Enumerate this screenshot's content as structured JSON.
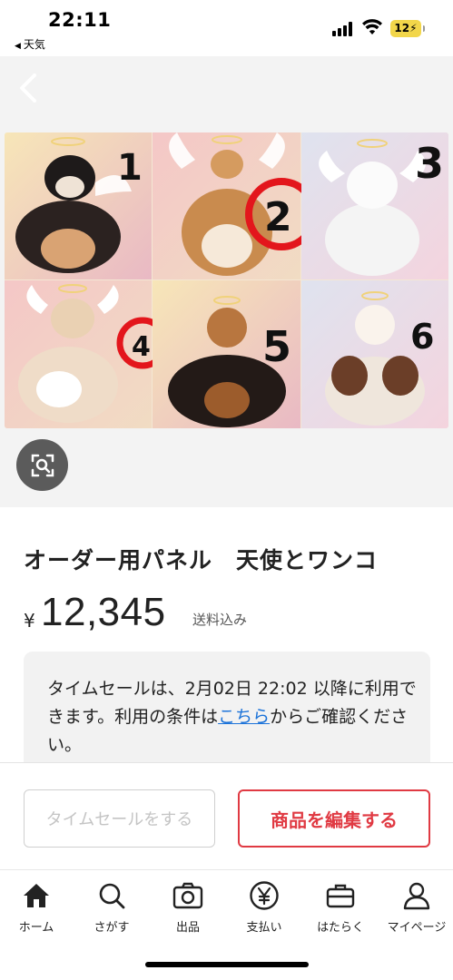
{
  "status_bar": {
    "time": "22:11",
    "back_app": "天気",
    "battery": "12"
  },
  "viewer": {
    "image_labels": [
      "1",
      "2",
      "3",
      "4",
      "5",
      "6"
    ]
  },
  "product": {
    "title": "オーダー用パネル　天使とワンコ",
    "currency": "¥",
    "price": "12,345",
    "shipping": "送料込み",
    "notice_part1": "タイムセールは、2月02日 22:02 以降に利用できます。利用の条件は",
    "notice_link": "こちら",
    "notice_part2": "からご確認ください。"
  },
  "actions": {
    "timesale_label": "タイムセールをする",
    "edit_label": "商品を編集する"
  },
  "tabs": [
    {
      "label": "ホーム",
      "icon": "home-icon"
    },
    {
      "label": "さがす",
      "icon": "search-icon"
    },
    {
      "label": "出品",
      "icon": "camera-icon"
    },
    {
      "label": "支払い",
      "icon": "yen-icon"
    },
    {
      "label": "はたらく",
      "icon": "briefcase-icon"
    },
    {
      "label": "マイページ",
      "icon": "person-icon"
    }
  ],
  "colors": {
    "accent": "#e03a43",
    "link": "#1c73d9",
    "battery": "#f2d64a"
  }
}
